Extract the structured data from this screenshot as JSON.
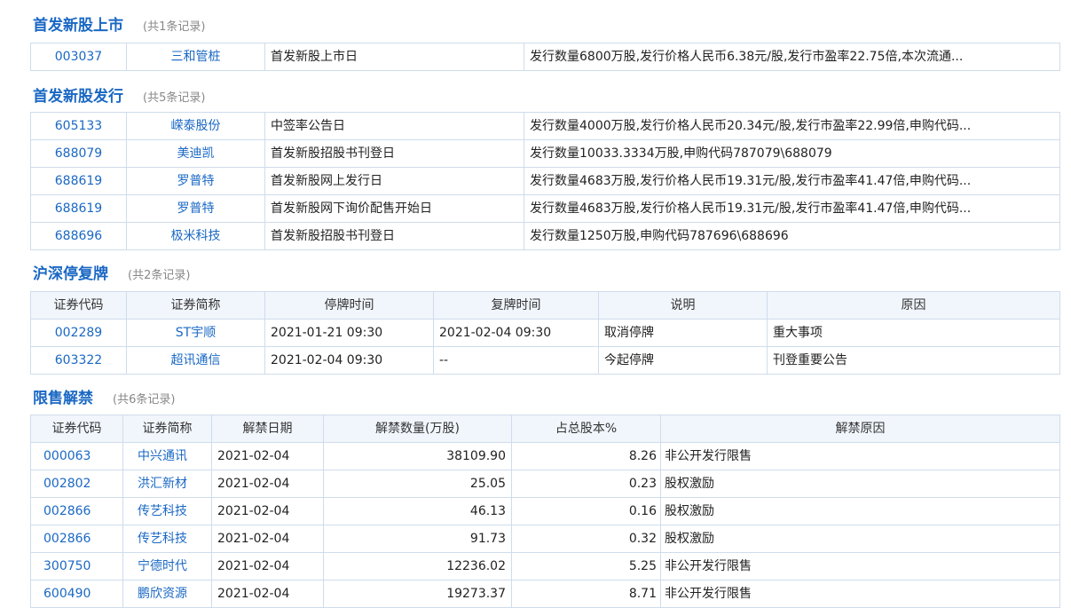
{
  "sec1": {
    "title": "首发新股上市",
    "count": "(共1条记录)",
    "rows": [
      {
        "code": "003037",
        "name": "三和管桩",
        "event": "首发新股上市日",
        "desc": "发行数量6800万股,发行价格人民币6.38元/股,发行市盈率22.75倍,本次流通..."
      }
    ]
  },
  "sec2": {
    "title": "首发新股发行",
    "count": "(共5条记录)",
    "rows": [
      {
        "code": "605133",
        "name": "嵘泰股份",
        "event": "中签率公告日",
        "desc": "发行数量4000万股,发行价格人民币20.34元/股,发行市盈率22.99倍,申购代码..."
      },
      {
        "code": "688079",
        "name": "美迪凯",
        "event": "首发新股招股书刊登日",
        "desc": "发行数量10033.3334万股,申购代码787079\\688079"
      },
      {
        "code": "688619",
        "name": "罗普特",
        "event": "首发新股网上发行日",
        "desc": "发行数量4683万股,发行价格人民币19.31元/股,发行市盈率41.47倍,申购代码..."
      },
      {
        "code": "688619",
        "name": "罗普特",
        "event": "首发新股网下询价配售开始日",
        "desc": "发行数量4683万股,发行价格人民币19.31元/股,发行市盈率41.47倍,申购代码..."
      },
      {
        "code": "688696",
        "name": "极米科技",
        "event": "首发新股招股书刊登日",
        "desc": "发行数量1250万股,申购代码787696\\688696"
      }
    ]
  },
  "sec3": {
    "title": "沪深停复牌",
    "count": "(共2条记录)",
    "headers": [
      "证券代码",
      "证券简称",
      "停牌时间",
      "复牌时间",
      "说明",
      "原因"
    ],
    "rows": [
      {
        "code": "002289",
        "name": "ST宇顺",
        "stop": "2021-01-21 09:30",
        "resume": "2021-02-04 09:30",
        "note": "取消停牌",
        "reason": "重大事项"
      },
      {
        "code": "603322",
        "name": "超讯通信",
        "stop": "2021-02-04 09:30",
        "resume": "--",
        "note": "今起停牌",
        "reason": "刊登重要公告"
      }
    ]
  },
  "sec4": {
    "title": "限售解禁",
    "count": "(共6条记录)",
    "headers": [
      "证券代码",
      "证券简称",
      "解禁日期",
      "解禁数量(万股)",
      "占总股本%",
      "解禁原因"
    ],
    "rows": [
      {
        "code": "000063",
        "name": "中兴通讯",
        "date": "2021-02-04",
        "qty": "38109.90",
        "pct": "8.26",
        "reason": "非公开发行限售"
      },
      {
        "code": "002802",
        "name": "洪汇新材",
        "date": "2021-02-04",
        "qty": "25.05",
        "pct": "0.23",
        "reason": "股权激励"
      },
      {
        "code": "002866",
        "name": "传艺科技",
        "date": "2021-02-04",
        "qty": "46.13",
        "pct": "0.16",
        "reason": "股权激励"
      },
      {
        "code": "002866",
        "name": "传艺科技",
        "date": "2021-02-04",
        "qty": "91.73",
        "pct": "0.32",
        "reason": "股权激励"
      },
      {
        "code": "300750",
        "name": "宁德时代",
        "date": "2021-02-04",
        "qty": "12236.02",
        "pct": "5.25",
        "reason": "非公开发行限售"
      },
      {
        "code": "600490",
        "name": "鹏欣资源",
        "date": "2021-02-04",
        "qty": "19273.37",
        "pct": "8.71",
        "reason": "非公开发行限售"
      }
    ]
  }
}
